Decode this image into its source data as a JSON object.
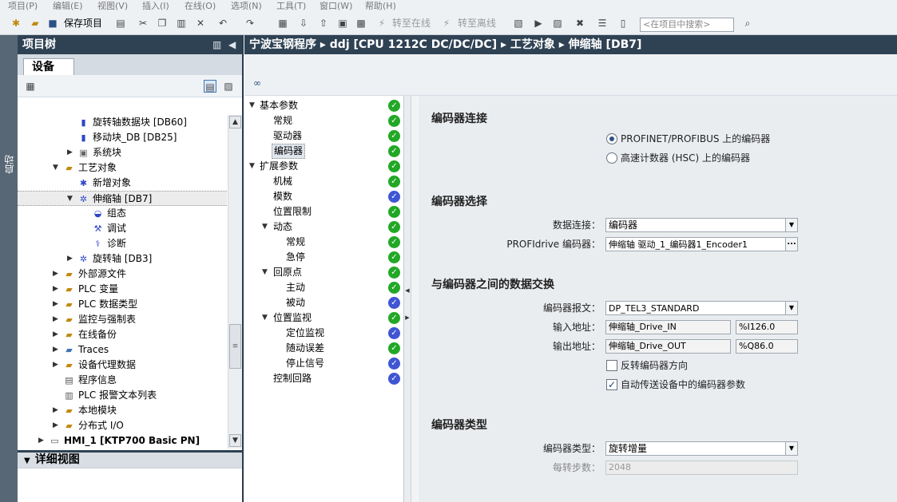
{
  "menubar": {
    "items": [
      "项目(P)",
      "编辑(E)",
      "视图(V)",
      "插入(I)",
      "在线(O)",
      "选项(N)",
      "工具(T)",
      "窗口(W)",
      "帮助(H)"
    ]
  },
  "toolbar": {
    "save_label": "保存项目",
    "go_online": "转至在线",
    "go_offline": "转至离线",
    "search_placeholder": "<在项目中搜索>"
  },
  "sidebar_strip": {
    "label": "启动"
  },
  "project_tree": {
    "title": "项目树",
    "devices_tab": "设备",
    "items": [
      {
        "label": "旋转轴数据块 [DB60]",
        "icon": "db-icon"
      },
      {
        "label": "移动块_DB [DB25]",
        "icon": "db-icon"
      },
      {
        "label": "系统块",
        "icon": "system-block-icon"
      },
      {
        "label": "工艺对象",
        "icon": "folder-icon"
      },
      {
        "label": "新增对象",
        "icon": "new-object-icon"
      },
      {
        "label": "伸缩轴 [DB7]",
        "icon": "axis-icon"
      },
      {
        "label": "组态",
        "icon": "config-icon"
      },
      {
        "label": "调试",
        "icon": "commissioning-icon"
      },
      {
        "label": "诊断",
        "icon": "diagnostics-icon"
      },
      {
        "label": "旋转轴 [DB3]",
        "icon": "axis-icon"
      },
      {
        "label": "外部源文件",
        "icon": "folder-icon"
      },
      {
        "label": "PLC 变量",
        "icon": "folder-icon"
      },
      {
        "label": "PLC 数据类型",
        "icon": "folder-icon"
      },
      {
        "label": "监控与强制表",
        "icon": "folder-icon"
      },
      {
        "label": "在线备份",
        "icon": "folder-icon"
      },
      {
        "label": "Traces",
        "icon": "folder-icon"
      },
      {
        "label": "设备代理数据",
        "icon": "folder-icon"
      },
      {
        "label": "程序信息",
        "icon": "program-info-icon"
      },
      {
        "label": "PLC 报警文本列表",
        "icon": "alarm-list-icon"
      },
      {
        "label": "本地模块",
        "icon": "folder-icon"
      },
      {
        "label": "分布式 I/O",
        "icon": "folder-icon"
      },
      {
        "label": "HMI_1 [KTP700 Basic PN]",
        "icon": "hmi-icon"
      }
    ],
    "detail_view": "详细视图"
  },
  "breadcrumb": {
    "project": "宁波宝钢程序",
    "cpu": "ddj [CPU 1212C DC/DC/DC]",
    "tech": "工艺对象",
    "axis": "伸缩轴 [DB7]"
  },
  "nav": {
    "items": [
      {
        "label": "基本参数",
        "status": "green"
      },
      {
        "label": "常规",
        "status": "green"
      },
      {
        "label": "驱动器",
        "status": "green"
      },
      {
        "label": "编码器",
        "status": "green"
      },
      {
        "label": "扩展参数",
        "status": "green"
      },
      {
        "label": "机械",
        "status": "green"
      },
      {
        "label": "模数",
        "status": "blue"
      },
      {
        "label": "位置限制",
        "status": "green"
      },
      {
        "label": "动态",
        "status": "green"
      },
      {
        "label": "常规",
        "status": "green"
      },
      {
        "label": "急停",
        "status": "green"
      },
      {
        "label": "回原点",
        "status": "green"
      },
      {
        "label": "主动",
        "status": "green"
      },
      {
        "label": "被动",
        "status": "blue"
      },
      {
        "label": "位置监视",
        "status": "green"
      },
      {
        "label": "定位监视",
        "status": "blue"
      },
      {
        "label": "随动误差",
        "status": "green"
      },
      {
        "label": "停止信号",
        "status": "blue"
      },
      {
        "label": "控制回路",
        "status": "blue"
      }
    ]
  },
  "encoder": {
    "connection_title": "编码器连接",
    "radio_profinet": "PROFINET/PROFIBUS 上的编码器",
    "radio_hsc": "高速计数器 (HSC) 上的编码器",
    "selection_title": "编码器选择",
    "data_conn_label": "数据连接：",
    "data_conn_value": "编码器",
    "profidrive_label": "PROFIdrive 编码器：",
    "profidrive_value": "伸缩轴 驱动_1_编码器1_Encoder1",
    "exchange_title": "与编码器之间的数据交换",
    "telegram_label": "编码器报文：",
    "telegram_value": "DP_TEL3_STANDARD",
    "input_label": "输入地址：",
    "input_name": "伸缩轴_Drive_IN",
    "input_addr": "%I126.0",
    "output_label": "输出地址：",
    "output_name": "伸缩轴_Drive_OUT",
    "output_addr": "%Q86.0",
    "invert_label": "反转编码器方向",
    "invert_checked": false,
    "auto_transfer_label": "自动传送设备中的编码器参数",
    "auto_transfer_checked": true,
    "type_title": "编码器类型",
    "type_label": "编码器类型：",
    "type_value": "旋转增量",
    "steps_label": "每转步数：",
    "steps_value": "2048"
  }
}
